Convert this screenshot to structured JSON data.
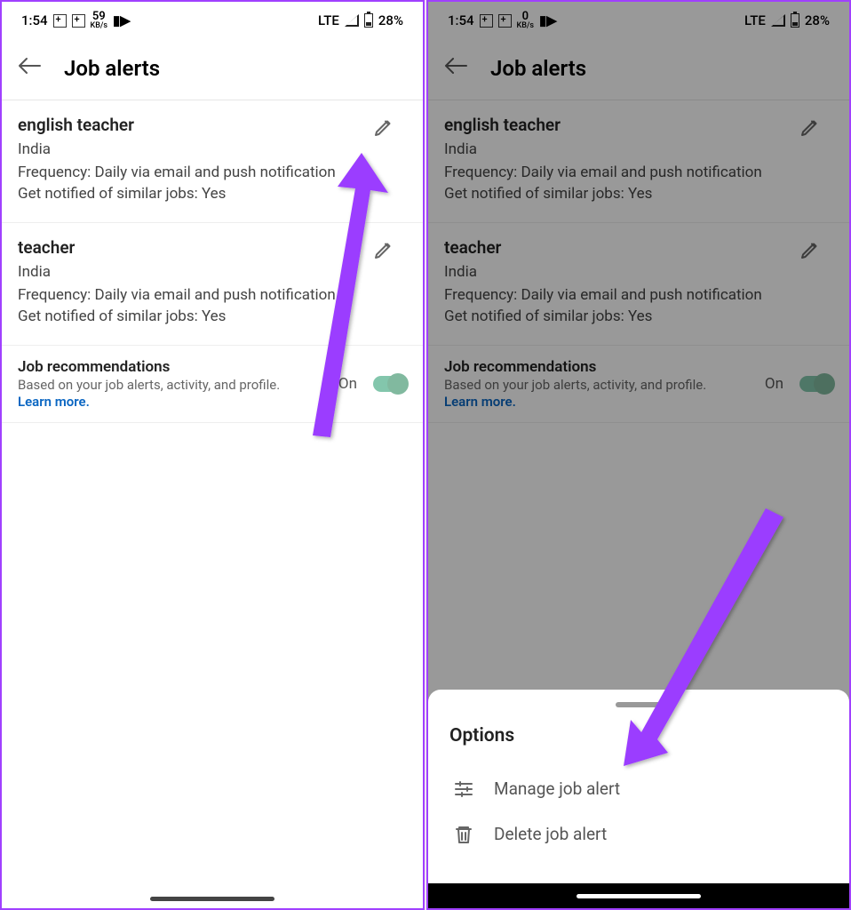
{
  "status": {
    "time": "1:54",
    "kbs_left": "59",
    "kbs_right": "0",
    "kbs_unit": "KB/s",
    "network": "LTE",
    "battery": "28%"
  },
  "header": {
    "title": "Job alerts"
  },
  "alerts": [
    {
      "title": "english teacher",
      "location": "India",
      "frequency": "Frequency: Daily via email and push notification",
      "notified": "Get notified of similar jobs: Yes"
    },
    {
      "title": "teacher",
      "location": "India",
      "frequency": "Frequency: Daily via email and push notification",
      "notified": "Get notified of similar jobs: Yes"
    }
  ],
  "recommendations": {
    "title": "Job recommendations",
    "desc": "Based on your job alerts, activity, and profile.",
    "link": "Learn more.",
    "status": "On"
  },
  "sheet": {
    "title": "Options",
    "manage": "Manage job alert",
    "delete": "Delete job alert"
  }
}
